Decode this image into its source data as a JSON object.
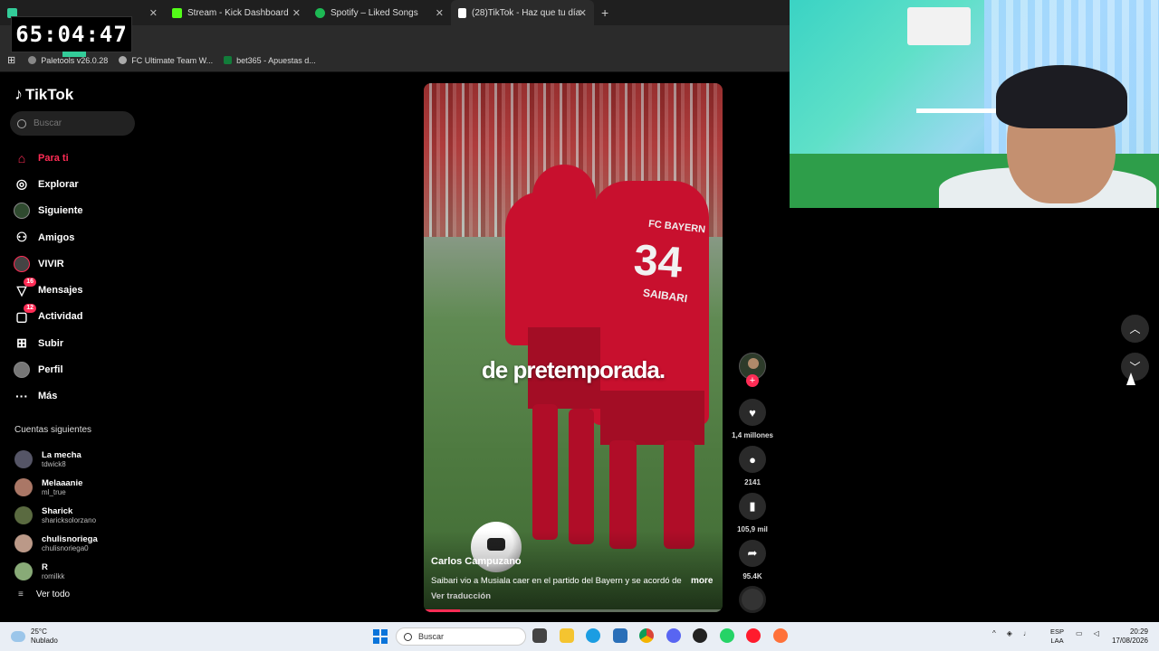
{
  "browser": {
    "tabs": [
      {
        "label": "",
        "color": "#3c9"
      },
      {
        "label": "Stream - Kick Dashboard",
        "color": "#53fc18"
      },
      {
        "label": "Spotify – Liked Songs",
        "color": "#1db954"
      },
      {
        "label": "(28)TikTok - Haz que tu día",
        "color": "#ffffff"
      }
    ],
    "bookmarks": [
      {
        "label": "Paletools v26.0.28",
        "color": "#888"
      },
      {
        "label": "FC Ultimate Team W...",
        "color": "#aaa"
      },
      {
        "label": "bet365 - Apuestas d...",
        "color": "#127c3a"
      }
    ]
  },
  "overlay": {
    "timer": "65:04:47"
  },
  "sidebar": {
    "brand": "TikTok",
    "search_placeholder": "Buscar",
    "nav": [
      {
        "label": "Para ti",
        "icon": "home-icon"
      },
      {
        "label": "Explorar",
        "icon": "compass-icon"
      },
      {
        "label": "Siguiente",
        "icon": "following-avatar-icon"
      },
      {
        "label": "Amigos",
        "icon": "friends-icon"
      },
      {
        "label": "VIVIR",
        "icon": "live-icon"
      },
      {
        "label": "Mensajes",
        "icon": "messages-icon",
        "badge": "16"
      },
      {
        "label": "Actividad",
        "icon": "activity-icon",
        "badge": "12"
      },
      {
        "label": "Subir",
        "icon": "upload-icon"
      },
      {
        "label": "Perfil",
        "icon": "profile-icon"
      },
      {
        "label": "Más",
        "icon": "more-icon"
      }
    ],
    "following_title": "Cuentas siguientes",
    "following": [
      {
        "name": "La mecha",
        "handle": "tdwick8"
      },
      {
        "name": "Melaaanie",
        "handle": "ml_true"
      },
      {
        "name": "Sharick",
        "handle": "sharicksolorzano"
      },
      {
        "name": "chulisnoriega",
        "handle": "chulisnoriega0"
      },
      {
        "name": "R",
        "handle": "romilkk"
      }
    ],
    "see_all": "Ver todo"
  },
  "video": {
    "caption": "de pretemporada.",
    "jersey_club": "FC BAYERN",
    "jersey_number": "34",
    "jersey_name": "SAIBARI",
    "author": "Carlos Campuzano",
    "description": "Saibari vio a Musiala caer en el partido del Bayern y se acordó de",
    "more": "more",
    "translate": "Ver traducción",
    "progress": 0.12
  },
  "actions": {
    "likes": "1,4 millones",
    "comments": "2141",
    "saves": "105,9 mil",
    "shares": "95.4K"
  },
  "taskbar": {
    "weather_temp": "25°C",
    "weather_desc": "Nublado",
    "search": "Buscar",
    "lang_top": "ESP",
    "lang_bottom": "LAA",
    "time": "20:29",
    "date": "17/08/2026"
  }
}
